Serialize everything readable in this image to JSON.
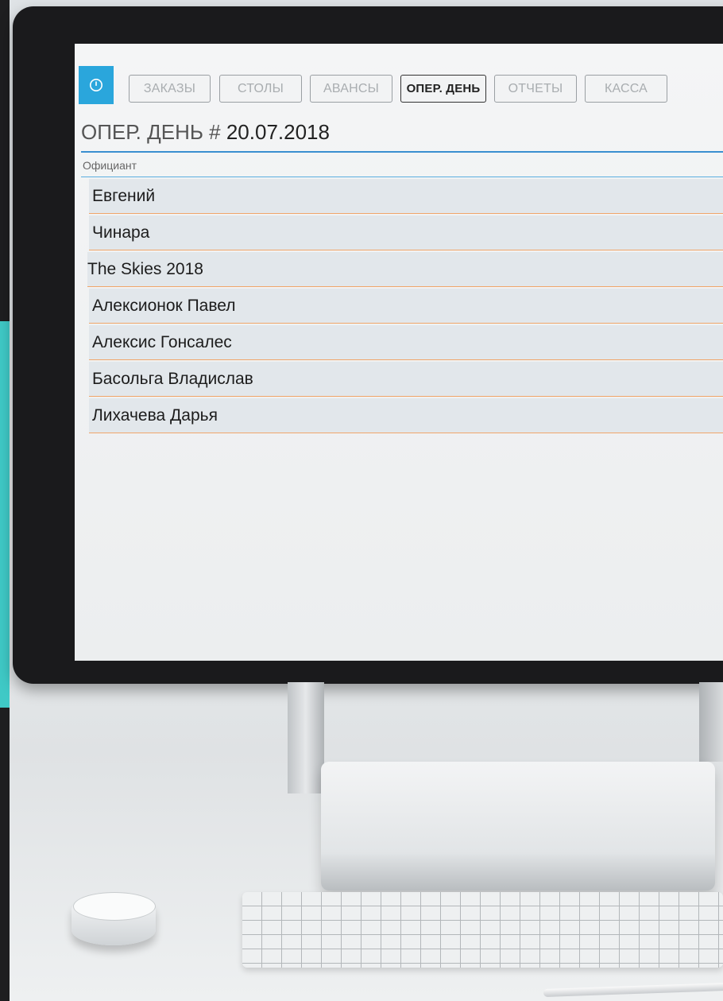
{
  "toolbar": {
    "tabs": [
      {
        "label": "ЗАКАЗЫ",
        "active": false
      },
      {
        "label": "СТОЛЫ",
        "active": false
      },
      {
        "label": "АВАНСЫ",
        "active": false
      },
      {
        "label": "ОПЕР. ДЕНЬ",
        "active": true
      },
      {
        "label": "ОТЧЕТЫ",
        "active": false
      },
      {
        "label": "КАССА",
        "active": false
      }
    ],
    "power_icon": "power-icon"
  },
  "page": {
    "title_prefix": "ОПЕР. ДЕНЬ #",
    "title_date": "20.07.2018"
  },
  "table": {
    "column_header": "Официант",
    "rows": [
      "Евгений",
      "Чинара",
      "The Skies 2018",
      "Алексионок Павел",
      "Алексис Гонсалес",
      "Басольга Владислав",
      "Лихачева Дарья"
    ]
  },
  "colors": {
    "accent_blue": "#2aa6dc",
    "row_divider": "#f0a66a",
    "left_accent": "#3fc9c6"
  }
}
